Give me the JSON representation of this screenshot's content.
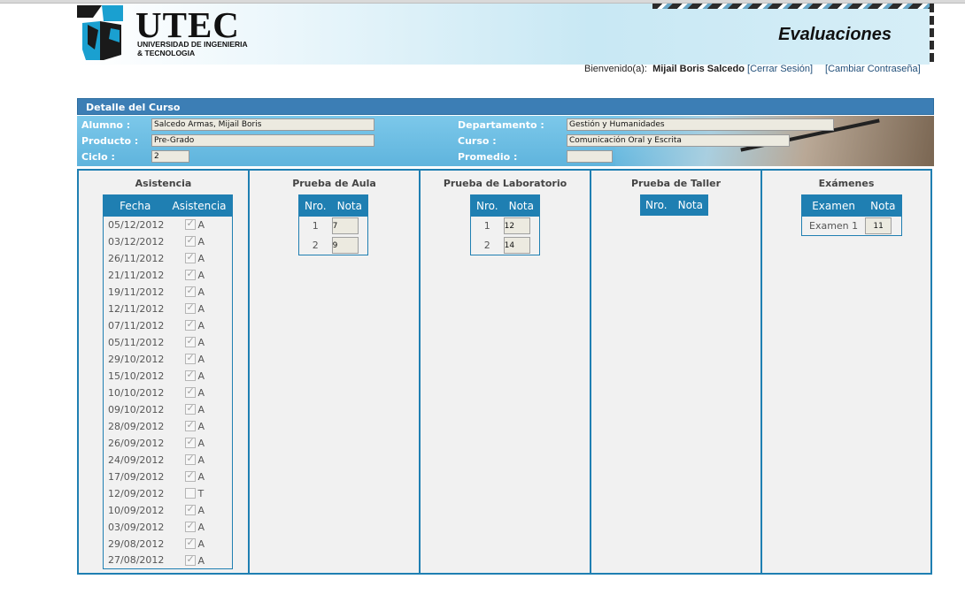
{
  "header": {
    "logo_text": "UTEC",
    "logo_subtitle_line1": "UNIVERSIDAD DE INGENIERIA",
    "logo_subtitle_line2": "& TECNOLOGIA",
    "app_title": "Evaluaciones"
  },
  "user_bar": {
    "welcome_label": "Bienvenido(a):",
    "user_name": "Mijail Boris Salcedo",
    "logout_link": "[Cerrar Sesión]",
    "change_password_link": "[Cambiar Contraseña]"
  },
  "detail": {
    "title": "Detalle del Curso",
    "alumno_label": "Alumno :",
    "alumno_value": "Salcedo Armas,   Mijail Boris",
    "producto_label": "Producto :",
    "producto_value": "Pre-Grado",
    "ciclo_label": "Ciclo :",
    "ciclo_value": "2",
    "departamento_label": "Departamento :",
    "departamento_value": "Gestión y Humanidades",
    "curso_label": "Curso :",
    "curso_value": "Comunicación Oral y Escrita",
    "promedio_label": "Promedio :",
    "promedio_value": ""
  },
  "asistencia": {
    "title": "Asistencia",
    "col_fecha": "Fecha",
    "col_asistencia": "Asistencia",
    "rows": [
      {
        "fecha": "05/12/2012",
        "checked": true,
        "valor": "A"
      },
      {
        "fecha": "03/12/2012",
        "checked": true,
        "valor": "A"
      },
      {
        "fecha": "26/11/2012",
        "checked": true,
        "valor": "A"
      },
      {
        "fecha": "21/11/2012",
        "checked": true,
        "valor": "A"
      },
      {
        "fecha": "19/11/2012",
        "checked": true,
        "valor": "A"
      },
      {
        "fecha": "12/11/2012",
        "checked": true,
        "valor": "A"
      },
      {
        "fecha": "07/11/2012",
        "checked": true,
        "valor": "A"
      },
      {
        "fecha": "05/11/2012",
        "checked": true,
        "valor": "A"
      },
      {
        "fecha": "29/10/2012",
        "checked": true,
        "valor": "A"
      },
      {
        "fecha": "15/10/2012",
        "checked": true,
        "valor": "A"
      },
      {
        "fecha": "10/10/2012",
        "checked": true,
        "valor": "A"
      },
      {
        "fecha": "09/10/2012",
        "checked": true,
        "valor": "A"
      },
      {
        "fecha": "28/09/2012",
        "checked": true,
        "valor": "A"
      },
      {
        "fecha": "26/09/2012",
        "checked": true,
        "valor": "A"
      },
      {
        "fecha": "24/09/2012",
        "checked": true,
        "valor": "A"
      },
      {
        "fecha": "17/09/2012",
        "checked": true,
        "valor": "A"
      },
      {
        "fecha": "12/09/2012",
        "checked": false,
        "valor": "T"
      },
      {
        "fecha": "10/09/2012",
        "checked": true,
        "valor": "A"
      },
      {
        "fecha": "03/09/2012",
        "checked": true,
        "valor": "A"
      },
      {
        "fecha": "29/08/2012",
        "checked": true,
        "valor": "A"
      },
      {
        "fecha": "27/08/2012",
        "checked": true,
        "valor": "A"
      }
    ]
  },
  "prueba_aula": {
    "title": "Prueba de Aula",
    "col_nro": "Nro.",
    "col_nota": "Nota",
    "rows": [
      {
        "nro": "1",
        "nota": "7"
      },
      {
        "nro": "2",
        "nota": "9"
      }
    ]
  },
  "prueba_laboratorio": {
    "title": "Prueba de Laboratorio",
    "col_nro": "Nro.",
    "col_nota": "Nota",
    "rows": [
      {
        "nro": "1",
        "nota": "12"
      },
      {
        "nro": "2",
        "nota": "14"
      }
    ]
  },
  "prueba_taller": {
    "title": "Prueba de Taller",
    "col_nro": "Nro.",
    "col_nota": "Nota",
    "rows": []
  },
  "examenes": {
    "title": "Exámenes",
    "col_examen": "Examen",
    "col_nota": "Nota",
    "rows": [
      {
        "examen": "Examen 1",
        "nota": "11"
      }
    ]
  },
  "colors": {
    "accent": "#1f7fb2",
    "header_bar": "#3c7eb5",
    "detail_bg": "#6cbde3"
  }
}
